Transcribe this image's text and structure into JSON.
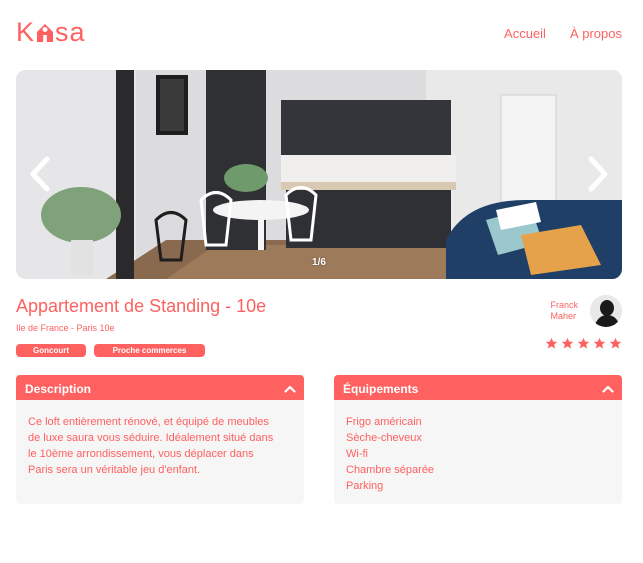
{
  "brand": {
    "logo_part1": "K",
    "logo_part2": "sa",
    "accent_color": "#FF6060"
  },
  "nav": {
    "home": "Accueil",
    "about": "À propos"
  },
  "gallery": {
    "counter": "1/6",
    "prev_icon": "chevron-left-icon",
    "next_icon": "chevron-right-icon"
  },
  "listing": {
    "title": "Appartement de Standing - 10e",
    "location": "Ile de France - Paris 10e",
    "tags": [
      "Goncourt",
      "Proche commerces"
    ],
    "host_first": "Franck",
    "host_last": "Maher",
    "rating": 5,
    "rating_max": 5
  },
  "description": {
    "title": "Description",
    "text": "Ce loft entièrement rénové, et équipé de meubles de luxe saura vous séduire. Idéalement situé dans le 10ème arrondissement, vous déplacer dans Paris sera un véritable jeu d'enfant."
  },
  "equipments": {
    "title": "Équipements",
    "items": [
      "Frigo américain",
      "Sèche-cheveux",
      "Wi-fi",
      "Chambre séparée",
      "Parking"
    ]
  }
}
